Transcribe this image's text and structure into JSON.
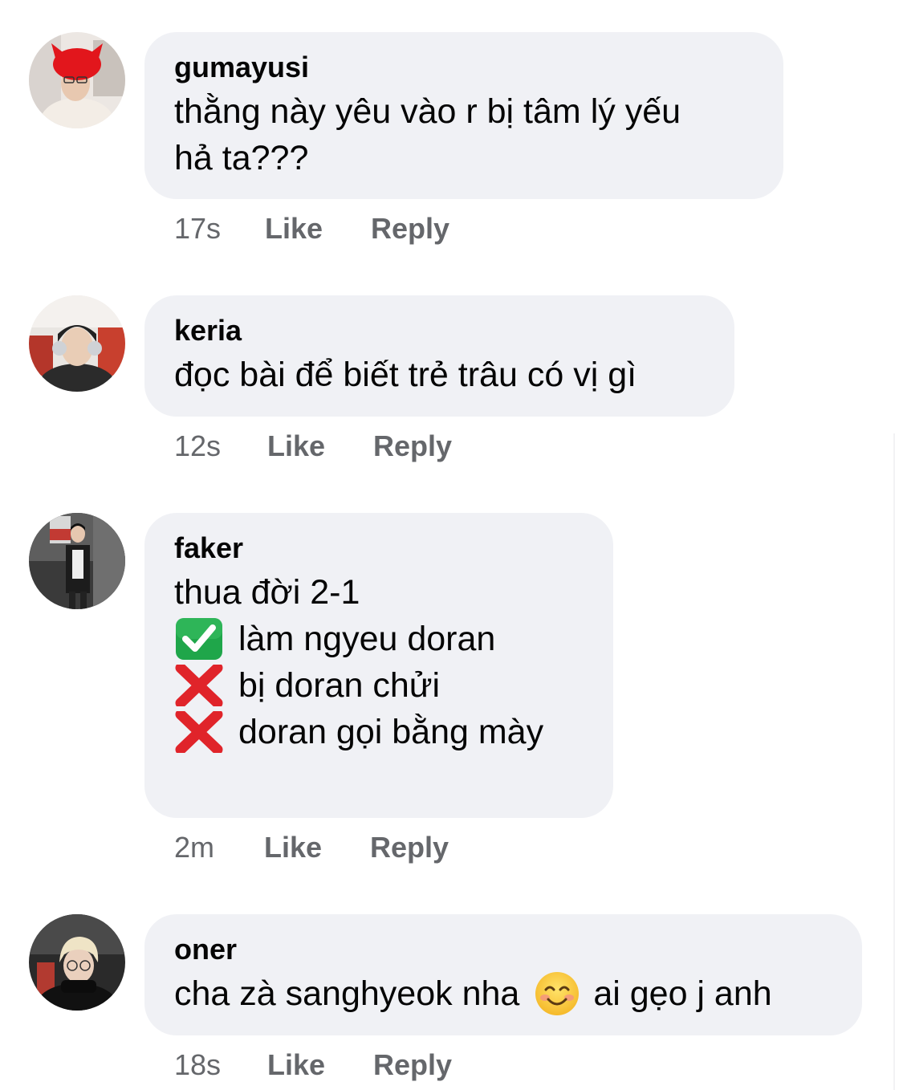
{
  "comments": [
    {
      "author": "gumayusi",
      "lines": [
        "thằng này yêu vào r bị tâm lý yếu",
        "hả ta???"
      ],
      "time": "17s",
      "like_label": "Like",
      "reply_label": "Reply"
    },
    {
      "author": "keria",
      "lines": [
        "đọc bài để biết trẻ trâu có vị gì"
      ],
      "time": "12s",
      "like_label": "Like",
      "reply_label": "Reply"
    },
    {
      "author": "faker",
      "lines": [
        "thua đời 2-1",
        "làm ngyeu doran",
        "bị doran chửi",
        "doran gọi bằng mày"
      ],
      "line_icons": [
        "",
        "check-mark-emoji",
        "cross-mark-emoji",
        "cross-mark-emoji"
      ],
      "time": "2m",
      "like_label": "Like",
      "reply_label": "Reply"
    },
    {
      "author": "oner",
      "text_before": "cha zà sanghyeok nha",
      "text_after": "ai gẹo j anh",
      "inline_icon": "smiling-face-emoji",
      "time": "18s",
      "like_label": "Like",
      "reply_label": "Reply"
    }
  ],
  "colors": {
    "bubble": "#f0f1f5",
    "text": "#050505",
    "meta": "#65676b",
    "check": "#1fa64a",
    "cross": "#e0242a"
  }
}
